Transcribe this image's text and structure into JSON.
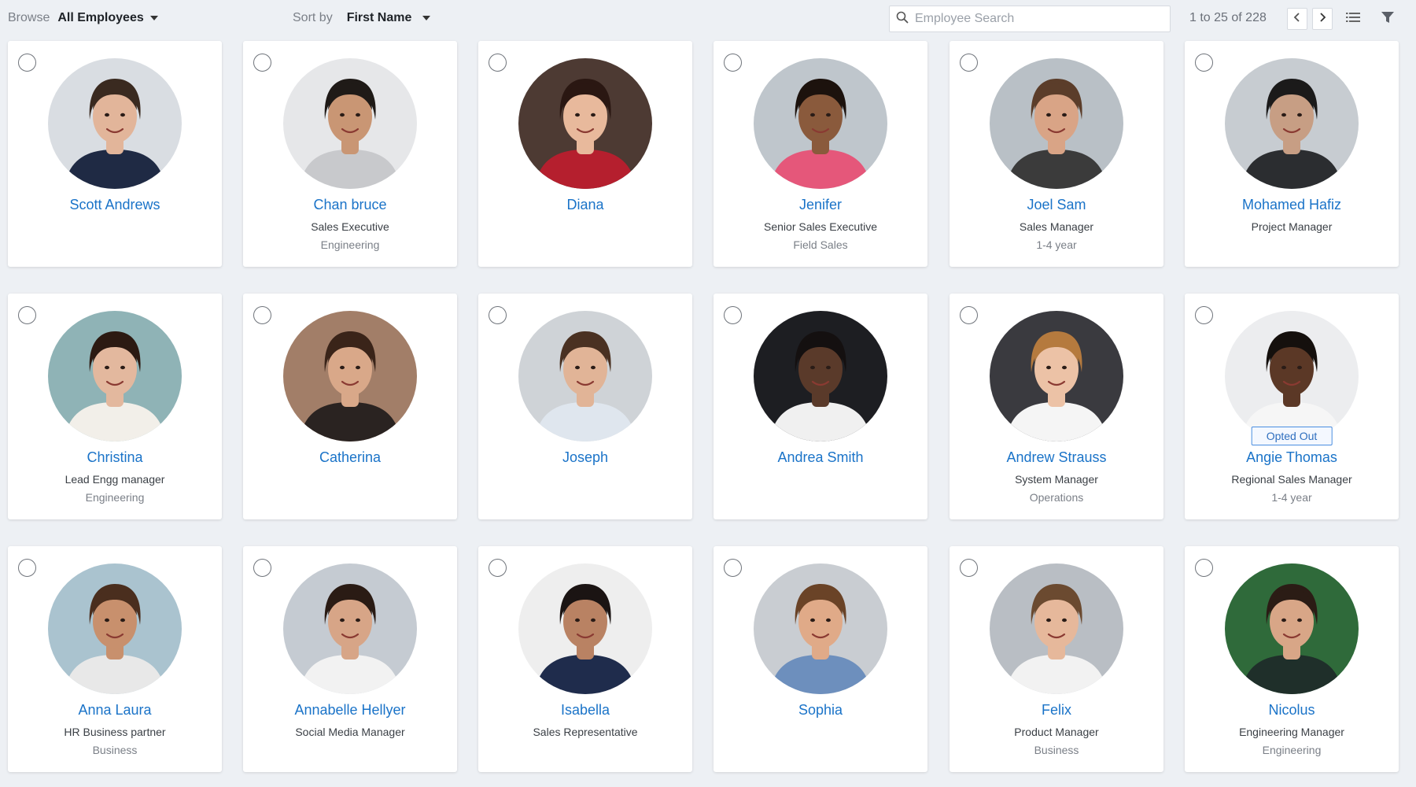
{
  "toolbar": {
    "browse_label": "Browse",
    "browse_value": "All Employees",
    "sort_label": "Sort by",
    "sort_value": "First Name",
    "search_placeholder": "Employee Search",
    "search_value": "",
    "pager_text": "1 to 25 of 228",
    "prev_icon": "chevron-left-icon",
    "next_icon": "chevron-right-icon",
    "list_view_icon": "list-view-icon",
    "filter_icon": "filter-icon"
  },
  "colors": {
    "accent": "#1a73c8",
    "background": "#edf0f4",
    "card": "#ffffff"
  },
  "employees": [
    {
      "name": "Scott Andrews",
      "title": "",
      "dept": "",
      "badge": "",
      "skin": "#e2b59a",
      "hair": "#3a2a20",
      "bg": "#d9dde2",
      "shirt": "#1f2a44"
    },
    {
      "name": "Chan bruce",
      "title": "Sales Executive",
      "dept": "Engineering",
      "badge": "",
      "skin": "#c99674",
      "hair": "#1f1a17",
      "bg": "#e6e7e9",
      "shirt": "#c8c9cc"
    },
    {
      "name": "Diana",
      "title": "",
      "dept": "",
      "badge": "",
      "skin": "#e8b99c",
      "hair": "#2a1712",
      "bg": "#4d3a33",
      "shirt": "#b51f2e"
    },
    {
      "name": "Jenifer",
      "title": "Senior Sales Executive",
      "dept": "Field Sales",
      "badge": "",
      "skin": "#8a5a3c",
      "hair": "#1c120d",
      "bg": "#bfc6cc",
      "shirt": "#e5577a"
    },
    {
      "name": "Joel Sam",
      "title": "Sales Manager",
      "dept": "1-4 year",
      "badge": "",
      "skin": "#d9a486",
      "hair": "#5b3d2a",
      "bg": "#b9c0c6",
      "shirt": "#3b3b3b"
    },
    {
      "name": "Mohamed Hafiz",
      "title": "Project Manager",
      "dept": "",
      "badge": "",
      "skin": "#c79e84",
      "hair": "#1b1a1a",
      "bg": "#c7ccd1",
      "shirt": "#2b2d30"
    },
    {
      "name": "Christina",
      "title": "Lead Engg manager",
      "dept": "Engineering",
      "badge": "",
      "skin": "#e3b89e",
      "hair": "#2c1a12",
      "bg": "#8fb3b6",
      "shirt": "#f2efe9"
    },
    {
      "name": "Catherina",
      "title": "",
      "dept": "",
      "badge": "",
      "skin": "#d9a889",
      "hair": "#3a2419",
      "bg": "#a27e68",
      "shirt": "#2a2321"
    },
    {
      "name": "Joseph",
      "title": "",
      "dept": "",
      "badge": "",
      "skin": "#e1b497",
      "hair": "#4a3122",
      "bg": "#cfd3d7",
      "shirt": "#dfe6ee"
    },
    {
      "name": "Andrea Smith",
      "title": "",
      "dept": "",
      "badge": "",
      "skin": "#5a3a2a",
      "hair": "#141010",
      "bg": "#1d1e22",
      "shirt": "#f0f0f0"
    },
    {
      "name": "Andrew Strauss",
      "title": "System Manager",
      "dept": "Operations",
      "badge": "",
      "skin": "#ecc2a6",
      "hair": "#b57a3e",
      "bg": "#3a3a3f",
      "shirt": "#f5f5f5"
    },
    {
      "name": "Angie Thomas",
      "title": "Regional Sales Manager",
      "dept": "1-4 year",
      "badge": "Opted Out",
      "skin": "#5b3826",
      "hair": "#15100d",
      "bg": "#ecedef",
      "shirt": "#f6f6f6"
    },
    {
      "name": "Anna Laura",
      "title": "HR Business partner",
      "dept": "Business",
      "badge": "",
      "skin": "#c8906d",
      "hair": "#4a2e1e",
      "bg": "#aac3cf",
      "shirt": "#e8e8e8"
    },
    {
      "name": "Annabelle Hellyer",
      "title": "Social Media Manager",
      "dept": "",
      "badge": "",
      "skin": "#d7a587",
      "hair": "#2a1b14",
      "bg": "#c5cbd2",
      "shirt": "#f2f2f2"
    },
    {
      "name": "Isabella",
      "title": "Sales Representative",
      "dept": "",
      "badge": "",
      "skin": "#b98263",
      "hair": "#1b1413",
      "bg": "#eeeeee",
      "shirt": "#1f2c4c"
    },
    {
      "name": "Sophia",
      "title": "",
      "dept": "",
      "badge": "",
      "skin": "#e0aa88",
      "hair": "#6a4327",
      "bg": "#c9cdd2",
      "shirt": "#6d8fbd"
    },
    {
      "name": "Felix",
      "title": "Product Manager",
      "dept": "Business",
      "badge": "",
      "skin": "#e6b89b",
      "hair": "#6b4a30",
      "bg": "#b9bec4",
      "shirt": "#f2f2f2"
    },
    {
      "name": "Nicolus",
      "title": "Engineering Manager",
      "dept": "Engineering",
      "badge": "",
      "skin": "#d8a687",
      "hair": "#2b1c15",
      "bg": "#2f6a3a",
      "shirt": "#1f2f2a"
    }
  ]
}
